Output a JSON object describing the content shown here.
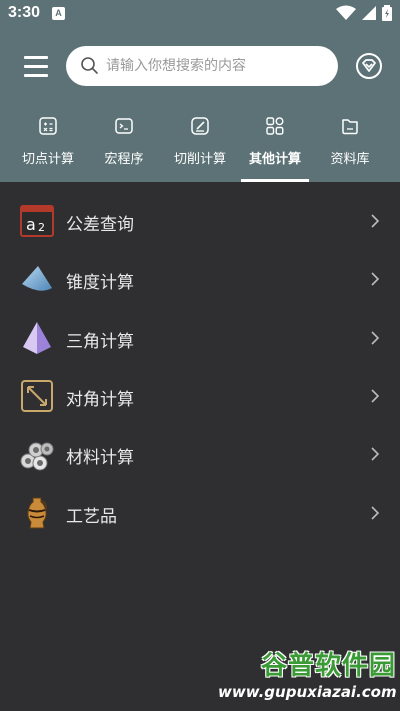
{
  "status_bar": {
    "time": "3:30",
    "app_badge": "A"
  },
  "search": {
    "placeholder": "请输入你想搜索的内容",
    "value": ""
  },
  "tabs": [
    {
      "label": "切点计算",
      "icon": "calculator-icon",
      "active": false
    },
    {
      "label": "宏程序",
      "icon": "terminal-icon",
      "active": false
    },
    {
      "label": "切削计算",
      "icon": "edit-icon",
      "active": false
    },
    {
      "label": "其他计算",
      "icon": "grid-icon",
      "active": true
    },
    {
      "label": "资料库",
      "icon": "folder-icon",
      "active": false
    }
  ],
  "items": [
    {
      "label": "公差查询",
      "icon": "tolerance-a2-icon"
    },
    {
      "label": "锥度计算",
      "icon": "cone-icon"
    },
    {
      "label": "三角计算",
      "icon": "pyramid-icon"
    },
    {
      "label": "对角计算",
      "icon": "diagonal-arrow-icon"
    },
    {
      "label": "材料计算",
      "icon": "pipes-icon"
    },
    {
      "label": "工艺品",
      "icon": "vase-icon"
    }
  ],
  "watermark": {
    "title": "谷普软件园",
    "url": "www.gupuxiazai.com"
  },
  "colors": {
    "header": "#5d7276",
    "background": "#2f2f31",
    "text": "#e8e8e8"
  }
}
